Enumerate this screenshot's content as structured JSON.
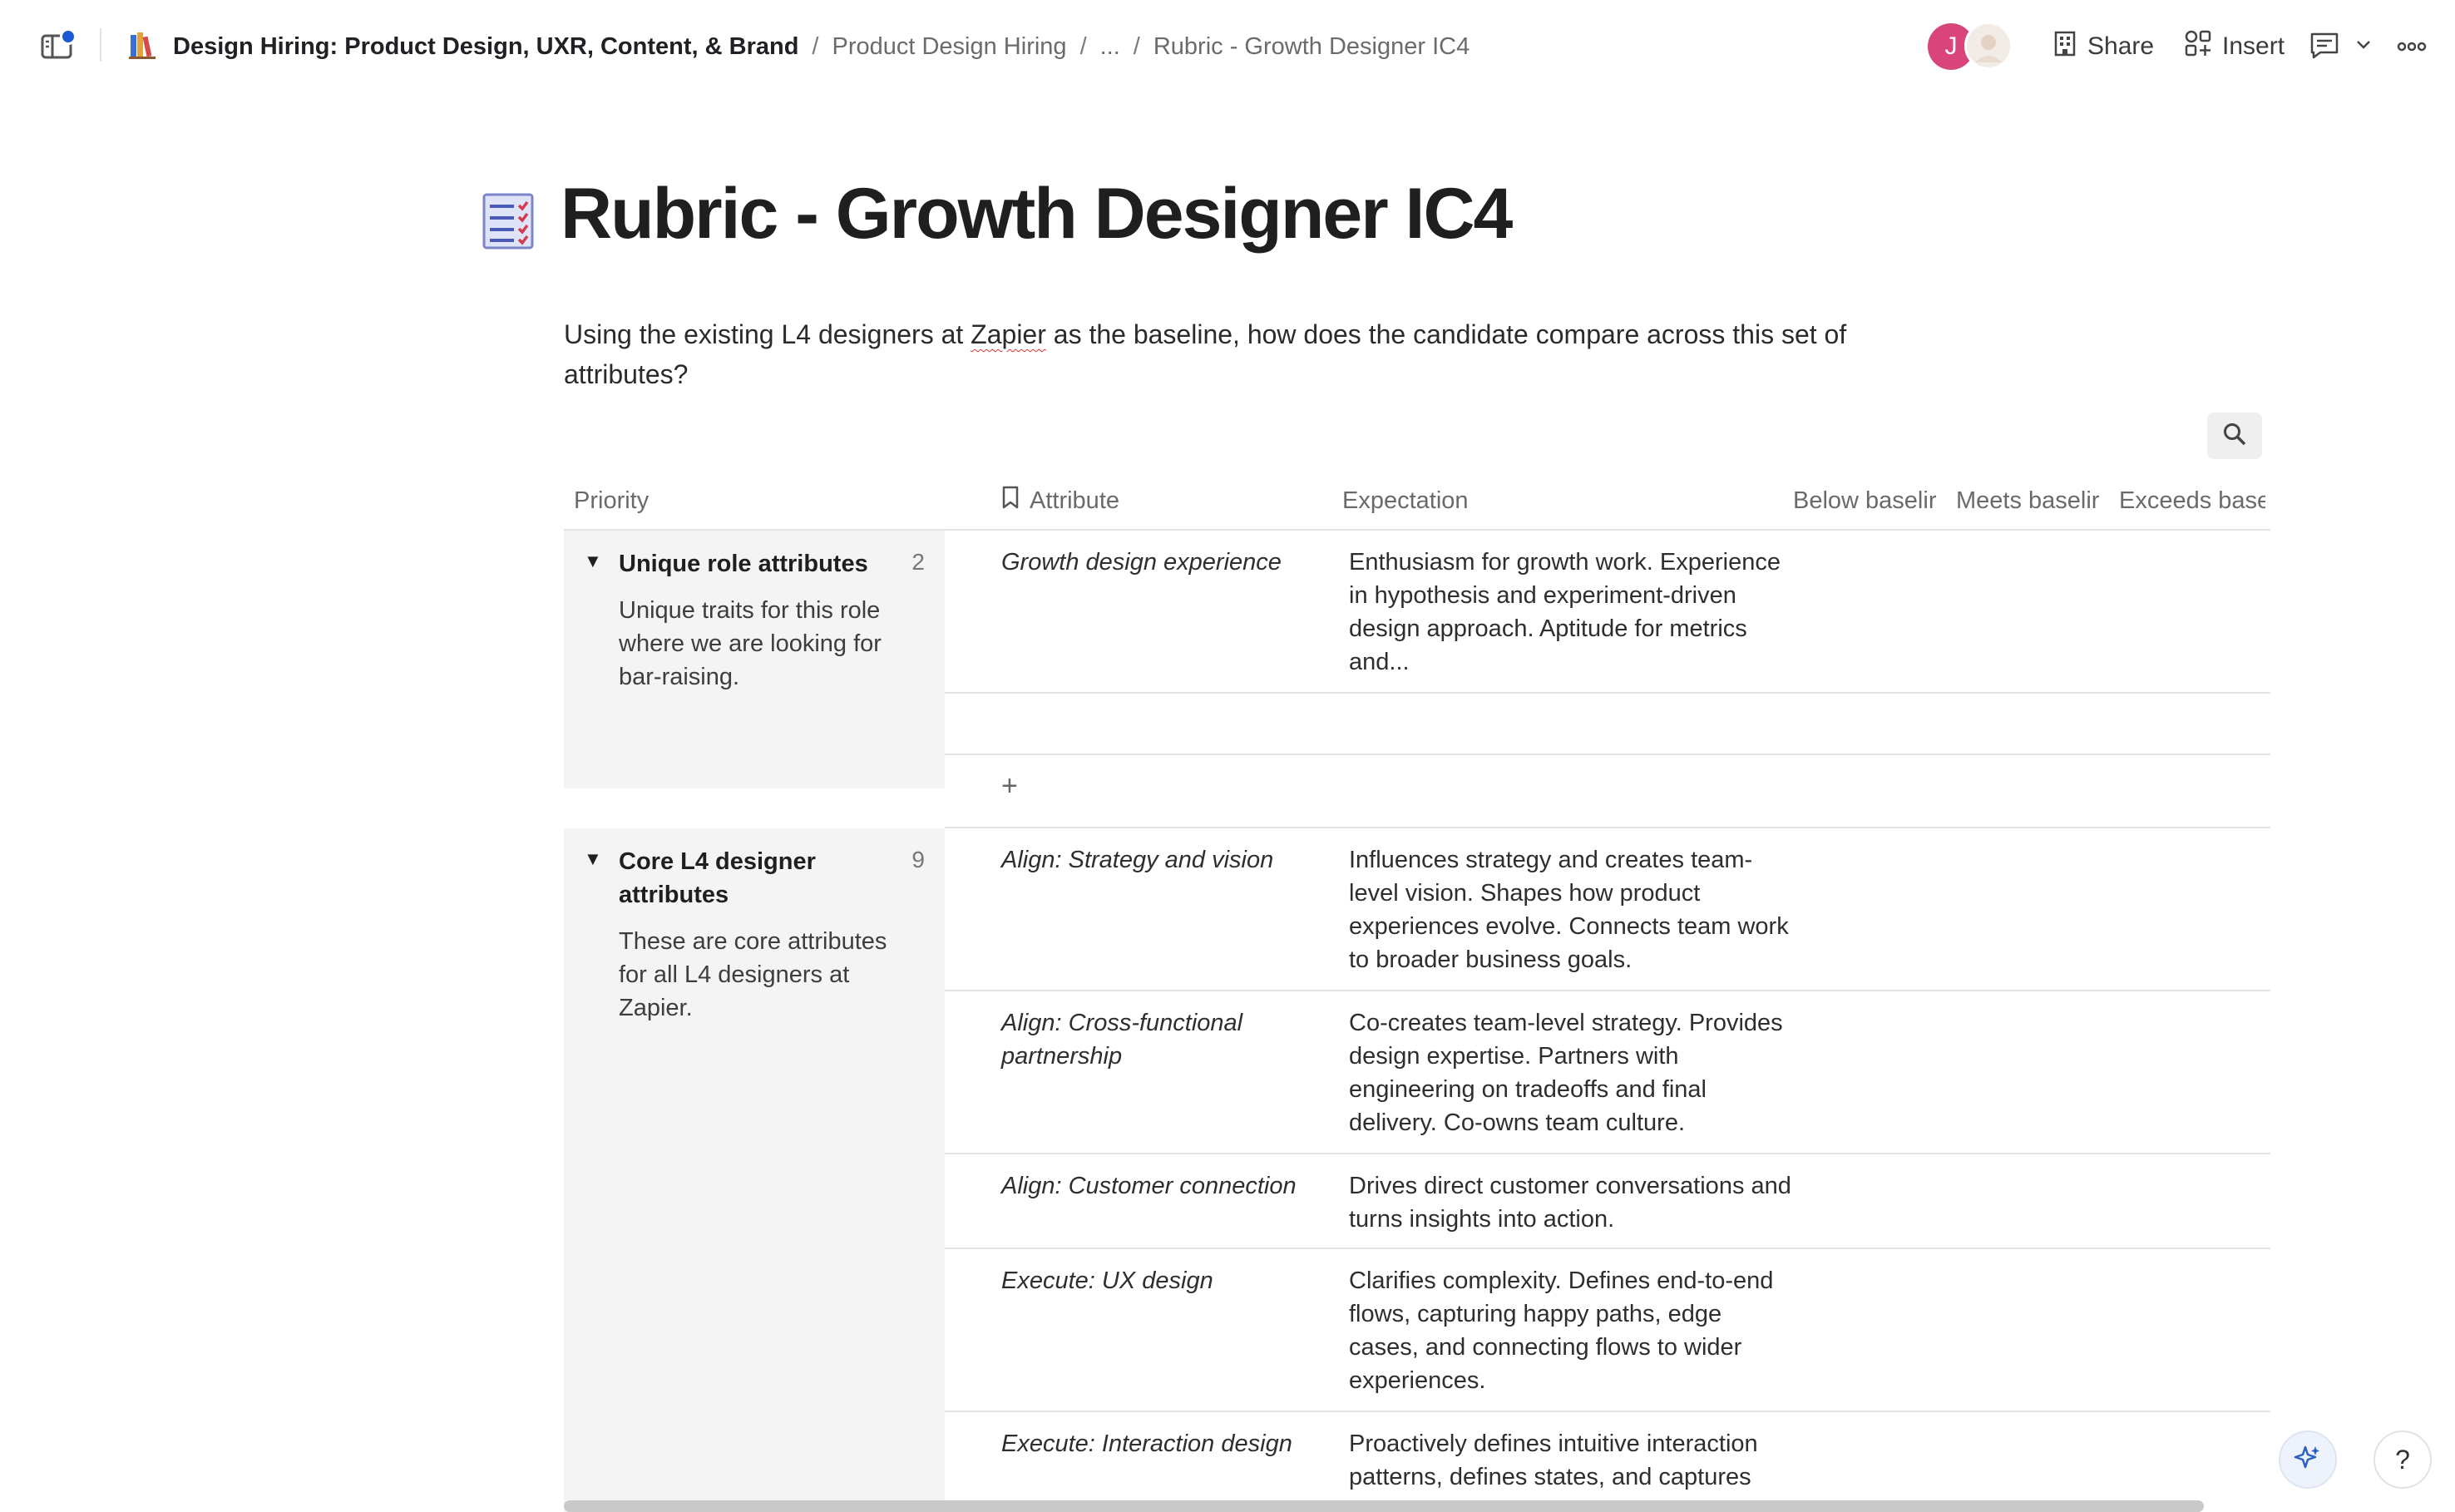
{
  "topbar": {
    "doc_title": "Design Hiring: Product Design, UXR, Content, & Brand",
    "breadcrumbs": [
      "Product Design Hiring",
      "...",
      "Rubric - Growth Designer IC4"
    ],
    "separator": "/",
    "avatar_initial": "J",
    "share_label": "Share",
    "insert_label": "Insert",
    "icons": [
      "sidebar-toggle-icon",
      "doc-books-icon",
      "building-icon",
      "insert-shapes-icon",
      "comment-icon",
      "chevron-down-icon",
      "more-icon"
    ]
  },
  "page": {
    "title": "Rubric - Growth Designer IC4",
    "intro_before": "Using the existing L4 designers at ",
    "intro_link": "Zapier",
    "intro_after": " as the baseline, how does the candidate compare across this set of attributes?"
  },
  "table": {
    "columns": [
      "Priority",
      "Attribute",
      "Expectation",
      "Below baselir",
      "Meets baselir",
      "Exceeds base"
    ],
    "add_row_label": "+",
    "groups": [
      {
        "title": "Unique role attributes",
        "count": "2",
        "description": "Unique traits for this role where we are looking for bar-raising.",
        "rows": [
          {
            "attribute": "Growth design experience",
            "expectation": "Enthusiasm for growth work. Experience in hypothesis and experiment-driven design approach. Aptitude for metrics and..."
          },
          {
            "attribute": "",
            "expectation": ""
          }
        ]
      },
      {
        "title": "Core L4 designer attributes",
        "count": "9",
        "description": "These are core attributes for all L4 designers at Zapier.",
        "rows": [
          {
            "attribute": "Align: Strategy and vision",
            "expectation": "Influences strategy and creates team-level vision. Shapes how product experiences evolve. Connects team work to broader business goals."
          },
          {
            "attribute": "Align: Cross-functional partnership",
            "expectation": "Co-creates team-level strategy. Provides design expertise. Partners with engineering on tradeoffs and final delivery. Co-owns team culture."
          },
          {
            "attribute": "Align: Customer connection",
            "expectation": "Drives direct customer conversations and turns insights into action."
          },
          {
            "attribute": "Execute: UX design",
            "expectation": "Clarifies complexity. Defines end-to-end flows, capturing happy paths, edge cases, and connecting flows to wider experiences."
          },
          {
            "attribute": "Execute: Interaction design",
            "expectation": "Proactively defines intuitive interaction patterns, defines states, and captures"
          }
        ]
      }
    ]
  },
  "floating": {
    "help_label": "?",
    "ai_icon": "sparkle-icon"
  },
  "colors": {
    "avatar": "#d9457a",
    "notification_dot": "#1b5bd1",
    "group_bg": "#f4f4f4"
  }
}
